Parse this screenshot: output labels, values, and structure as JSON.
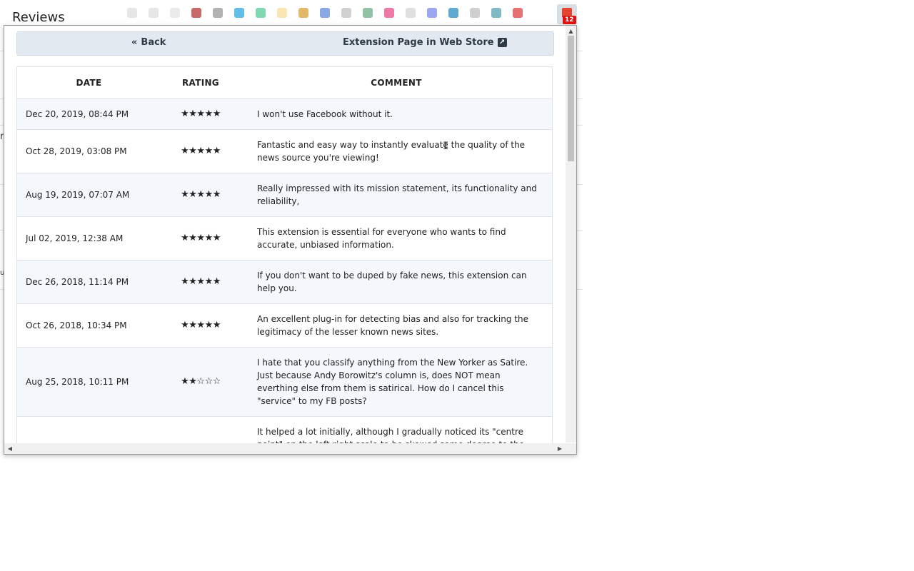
{
  "page": {
    "title": "Reviews"
  },
  "background": {
    "fragments": [
      "m",
      "u"
    ]
  },
  "toolbar": {
    "badge_count": "12"
  },
  "nav": {
    "back_icon": "«",
    "back_label": "Back",
    "store_label": "Extension Page in Web Store",
    "store_icon": "↗"
  },
  "table": {
    "headers": {
      "date": "DATE",
      "rating": "RATING",
      "comment": "COMMENT"
    },
    "rows": [
      {
        "date": "Dec 20, 2019, 08:44 PM",
        "rating": 5,
        "stars": "★★★★★",
        "comment": "I won't use Facebook without it."
      },
      {
        "date": "Oct 28, 2019, 03:08 PM",
        "rating": 5,
        "stars": "★★★★★",
        "comment": "Fantastic and easy way to instantly evaluate the quality of the news source you're viewing!"
      },
      {
        "date": "Aug 19, 2019, 07:07 AM",
        "rating": 5,
        "stars": "★★★★★",
        "comment": "Really impressed with its mission statement, its functionality and reliability,"
      },
      {
        "date": "Jul 02, 2019, 12:38 AM",
        "rating": 5,
        "stars": "★★★★★",
        "comment": "This extension is essential for everyone who wants to find accurate, unbiased information."
      },
      {
        "date": "Dec 26, 2018, 11:14 PM",
        "rating": 5,
        "stars": "★★★★★",
        "comment": "If you don't want to be duped by fake news, this extension can help you."
      },
      {
        "date": "Oct 26, 2018, 10:34 PM",
        "rating": 5,
        "stars": "★★★★★",
        "comment": "An excellent plug-in for detecting bias and also for tracking the legitimacy of the lesser known news sites."
      },
      {
        "date": "Aug 25, 2018, 10:11 PM",
        "rating": 2,
        "stars": "★★☆☆☆",
        "comment": "I hate that you classify anything from the New Yorker as Satire. Just because Andy Borowitz's column is, does NOT mean everthing else from them is satirical. How do I cancel this \"service\" to my FB posts?"
      },
      {
        "date": "",
        "rating": null,
        "stars": "",
        "comment": "It helped a lot initially, although I gradually noticed its \"centre point\" on the left-right scale to be skewed some degree to the left. But I am very disappointed by the latest evaluations by this tool of"
      }
    ]
  },
  "scrollbar": {
    "up": "▲",
    "down": "▼",
    "left": "◀",
    "right": "▶"
  },
  "cursor": {
    "glyph": "I"
  },
  "colors": {
    "nav_bg": "#e3e9f0",
    "row_alt": "#f4f7fb",
    "badge": "#e01010"
  }
}
